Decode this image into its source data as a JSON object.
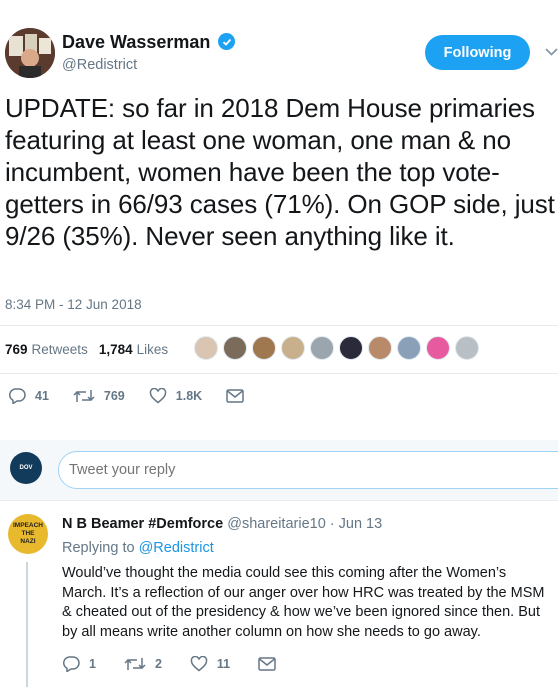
{
  "tweet": {
    "author_name": "Dave Wasserman",
    "author_handle": "@Redistrict",
    "follow_label": "Following",
    "text": "UPDATE: so far in 2018 Dem House primaries featuring at least one woman, one man & no incumbent, women have been the top vote-getters in 66/93 cases (71%). On GOP side, just 9/26 (35%). Never seen anything like it.",
    "timestamp": "8:34 PM - 12 Jun 2018",
    "retweets_count": "769",
    "retweets_label": "Retweets",
    "likes_count": "1,784",
    "likes_label": "Likes",
    "reply_count": "41",
    "retweet_action_count": "769",
    "like_action_count": "1.8K"
  },
  "liker_colors": [
    "#d9c5b2",
    "#7a6b5a",
    "#a07850",
    "#c8b08c",
    "#9aa5ad",
    "#2a2a3a",
    "#b88a6a",
    "#8aa0b8",
    "#e85aa0",
    "#b8c0c6"
  ],
  "compose": {
    "avatar_text": "DOV",
    "placeholder": "Tweet your reply"
  },
  "reply": {
    "avatar_lines": [
      "IMPEACH",
      "THE",
      "NAZI"
    ],
    "name": "N B Beamer #Demforce",
    "handle_date": "@shareitarie10 · Jun 13",
    "replying_prefix": "Replying to",
    "replying_to": "@Redistrict",
    "text": "Would’ve thought the media could see this coming after the Women’s March. It’s a reflection of our anger over how HRC was treated by the MSM & cheated out of the presidency & how we’ve been ignored since then. But by all means write another column on how she needs to go away.",
    "reply_count": "1",
    "retweet_count": "2",
    "like_count": "11"
  },
  "colors": {
    "accent": "#1da1f2",
    "muted": "#657786",
    "text": "#14171a"
  }
}
